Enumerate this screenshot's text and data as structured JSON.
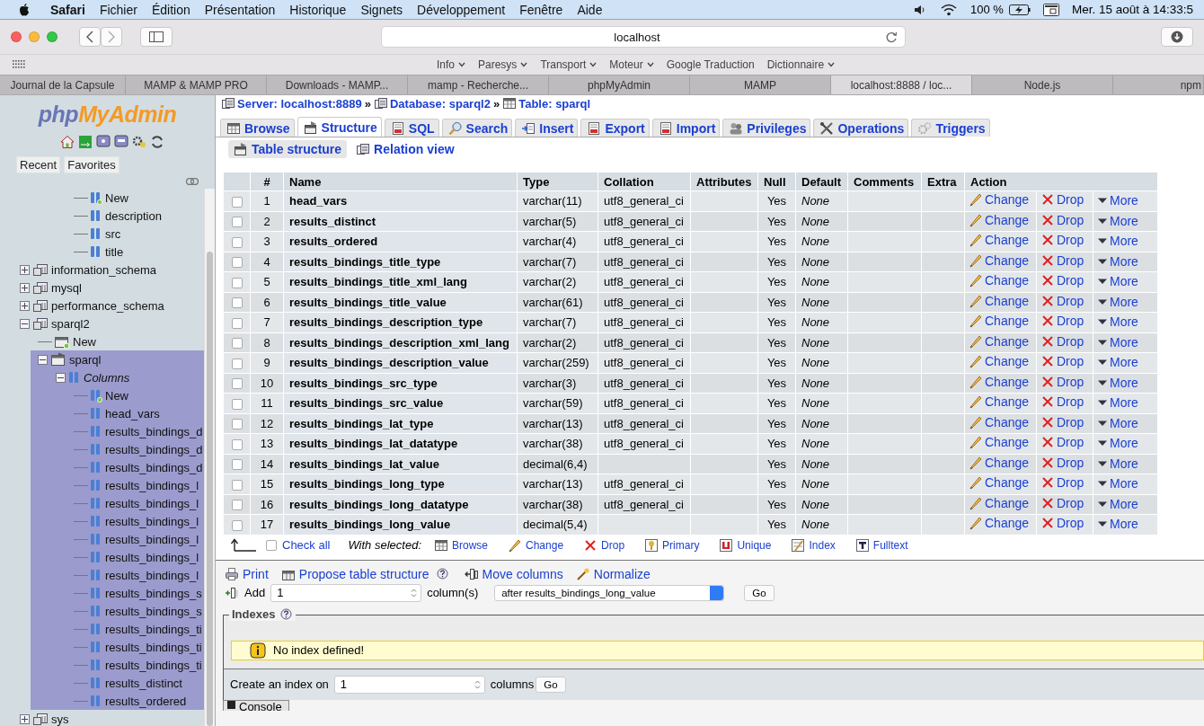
{
  "menu_bar": {
    "app": "Safari",
    "items": [
      "Fichier",
      "Édition",
      "Présentation",
      "Historique",
      "Signets",
      "Développement",
      "Fenêtre",
      "Aide"
    ],
    "battery": "100 %",
    "clock": "Mer. 15 août à 14:33:5"
  },
  "browser": {
    "address": "localhost",
    "favorites": [
      {
        "label": "Info",
        "dropdown": true
      },
      {
        "label": "Paresys",
        "dropdown": true
      },
      {
        "label": "Transport",
        "dropdown": true
      },
      {
        "label": "Moteur",
        "dropdown": true
      },
      {
        "label": "Google Traduction",
        "dropdown": false
      },
      {
        "label": "Dictionnaire",
        "dropdown": true
      }
    ],
    "tabs": [
      {
        "label": "Journal de la Capsule",
        "selected": false
      },
      {
        "label": "MAMP & MAMP PRO",
        "selected": false
      },
      {
        "label": "Downloads - MAMP...",
        "selected": false
      },
      {
        "label": "mamp - Recherche...",
        "selected": false
      },
      {
        "label": "phpMyAdmin",
        "selected": false
      },
      {
        "label": "MAMP",
        "selected": false
      },
      {
        "label": "localhost:8888 / loc...",
        "selected": true
      },
      {
        "label": "Node.js",
        "selected": false
      },
      {
        "label": "npm",
        "selected": false
      }
    ]
  },
  "sidebar": {
    "logo": {
      "first": "php",
      "second": "MyAdmin"
    },
    "buttons": [
      "Recent",
      "Favorites"
    ],
    "tree": [
      {
        "kind": "continued",
        "children": [
          {
            "kind": "continued",
            "children": [
              {
                "kind": "continued",
                "children": [
                  {
                    "label": "New",
                    "kind": "new-column"
                  },
                  {
                    "label": "description",
                    "kind": "column"
                  },
                  {
                    "label": "src",
                    "kind": "column"
                  },
                  {
                    "label": "title",
                    "kind": "column"
                  }
                ]
              }
            ]
          }
        ]
      },
      {
        "label": "information_schema",
        "kind": "database",
        "expanded": false,
        "selected": false
      },
      {
        "label": "mysql",
        "kind": "database",
        "expanded": false,
        "selected": false
      },
      {
        "label": "performance_schema",
        "kind": "database",
        "expanded": false,
        "selected": false
      },
      {
        "label": "sparql2",
        "kind": "database",
        "expanded": true,
        "selected": false,
        "children": [
          {
            "label": "New",
            "kind": "new-table"
          },
          {
            "label": "sparql",
            "kind": "table",
            "expanded": true,
            "selected": true,
            "children": [
              {
                "label": "Columns",
                "kind": "group",
                "expanded": true,
                "children": [
                  {
                    "label": "New",
                    "kind": "new-column"
                  },
                  {
                    "label": "head_vars",
                    "kind": "column"
                  },
                  {
                    "label": "results_bindings_d",
                    "kind": "column"
                  },
                  {
                    "label": "results_bindings_d",
                    "kind": "column"
                  },
                  {
                    "label": "results_bindings_d",
                    "kind": "column"
                  },
                  {
                    "label": "results_bindings_l",
                    "kind": "column"
                  },
                  {
                    "label": "results_bindings_l",
                    "kind": "column"
                  },
                  {
                    "label": "results_bindings_l",
                    "kind": "column"
                  },
                  {
                    "label": "results_bindings_l",
                    "kind": "column"
                  },
                  {
                    "label": "results_bindings_l",
                    "kind": "column"
                  },
                  {
                    "label": "results_bindings_l",
                    "kind": "column"
                  },
                  {
                    "label": "results_bindings_s",
                    "kind": "column"
                  },
                  {
                    "label": "results_bindings_s",
                    "kind": "column"
                  },
                  {
                    "label": "results_bindings_ti",
                    "kind": "column"
                  },
                  {
                    "label": "results_bindings_ti",
                    "kind": "column"
                  },
                  {
                    "label": "results_bindings_ti",
                    "kind": "column"
                  },
                  {
                    "label": "results_distinct",
                    "kind": "column"
                  },
                  {
                    "label": "results_ordered",
                    "kind": "column"
                  }
                ]
              }
            ]
          }
        ]
      },
      {
        "label": "sys",
        "kind": "database",
        "expanded": false,
        "selected": false
      }
    ]
  },
  "breadcrumb": [
    {
      "label": "Server: localhost:8889",
      "after": "»"
    },
    {
      "label": "Database: sparql2",
      "after": "»"
    },
    {
      "label": "Table: sparql"
    }
  ],
  "tabs": [
    {
      "label": "Browse",
      "selected": false
    },
    {
      "label": "Structure",
      "selected": true
    },
    {
      "label": "SQL",
      "selected": false
    },
    {
      "label": "Search",
      "selected": false
    },
    {
      "label": "Insert",
      "selected": false
    },
    {
      "label": "Export",
      "selected": false
    },
    {
      "label": "Import",
      "selected": false
    },
    {
      "label": "Privileges",
      "selected": false
    },
    {
      "label": "Operations",
      "selected": false
    },
    {
      "label": "Triggers",
      "selected": false
    }
  ],
  "subtabs": [
    {
      "label": "Table structure",
      "selected": true
    },
    {
      "label": "Relation view",
      "selected": false
    }
  ],
  "table": {
    "columns": [
      "#",
      "Name",
      "Type",
      "Collation",
      "Attributes",
      "Null",
      "Default",
      "Comments",
      "Extra",
      "Action"
    ],
    "rows": [
      {
        "checked": false,
        "num": "1",
        "name": "head_vars",
        "type": "varchar(11)",
        "collation": "utf8_general_ci",
        "null": "Yes",
        "default": "None",
        "actions": [
          "Change",
          "Drop",
          "More"
        ]
      },
      {
        "checked": false,
        "num": "2",
        "name": "results_distinct",
        "type": "varchar(5)",
        "collation": "utf8_general_ci",
        "null": "Yes",
        "default": "None",
        "actions": [
          "Change",
          "Drop",
          "More"
        ]
      },
      {
        "checked": false,
        "num": "3",
        "name": "results_ordered",
        "type": "varchar(4)",
        "collation": "utf8_general_ci",
        "null": "Yes",
        "default": "None",
        "actions": [
          "Change",
          "Drop",
          "More"
        ]
      },
      {
        "checked": false,
        "num": "4",
        "name": "results_bindings_title_type",
        "type": "varchar(7)",
        "collation": "utf8_general_ci",
        "null": "Yes",
        "default": "None",
        "actions": [
          "Change",
          "Drop",
          "More"
        ]
      },
      {
        "checked": false,
        "num": "5",
        "name": "results_bindings_title_xml_lang",
        "type": "varchar(2)",
        "collation": "utf8_general_ci",
        "null": "Yes",
        "default": "None",
        "actions": [
          "Change",
          "Drop",
          "More"
        ]
      },
      {
        "checked": false,
        "num": "6",
        "name": "results_bindings_title_value",
        "type": "varchar(61)",
        "collation": "utf8_general_ci",
        "null": "Yes",
        "default": "None",
        "actions": [
          "Change",
          "Drop",
          "More"
        ]
      },
      {
        "checked": false,
        "num": "7",
        "name": "results_bindings_description_type",
        "type": "varchar(7)",
        "collation": "utf8_general_ci",
        "null": "Yes",
        "default": "None",
        "actions": [
          "Change",
          "Drop",
          "More"
        ]
      },
      {
        "checked": false,
        "num": "8",
        "name": "results_bindings_description_xml_lang",
        "type": "varchar(2)",
        "collation": "utf8_general_ci",
        "null": "Yes",
        "default": "None",
        "actions": [
          "Change",
          "Drop",
          "More"
        ]
      },
      {
        "checked": false,
        "num": "9",
        "name": "results_bindings_description_value",
        "type": "varchar(259)",
        "collation": "utf8_general_ci",
        "null": "Yes",
        "default": "None",
        "actions": [
          "Change",
          "Drop",
          "More"
        ]
      },
      {
        "checked": false,
        "num": "10",
        "name": "results_bindings_src_type",
        "type": "varchar(3)",
        "collation": "utf8_general_ci",
        "null": "Yes",
        "default": "None",
        "actions": [
          "Change",
          "Drop",
          "More"
        ]
      },
      {
        "checked": false,
        "num": "11",
        "name": "results_bindings_src_value",
        "type": "varchar(59)",
        "collation": "utf8_general_ci",
        "null": "Yes",
        "default": "None",
        "actions": [
          "Change",
          "Drop",
          "More"
        ]
      },
      {
        "checked": false,
        "num": "12",
        "name": "results_bindings_lat_type",
        "type": "varchar(13)",
        "collation": "utf8_general_ci",
        "null": "Yes",
        "default": "None",
        "actions": [
          "Change",
          "Drop",
          "More"
        ]
      },
      {
        "checked": false,
        "num": "13",
        "name": "results_bindings_lat_datatype",
        "type": "varchar(38)",
        "collation": "utf8_general_ci",
        "null": "Yes",
        "default": "None",
        "actions": [
          "Change",
          "Drop",
          "More"
        ]
      },
      {
        "checked": false,
        "num": "14",
        "name": "results_bindings_lat_value",
        "type": "decimal(6,4)",
        "null": "Yes",
        "default": "None",
        "actions": [
          "Change",
          "Drop",
          "More"
        ]
      },
      {
        "checked": false,
        "num": "15",
        "name": "results_bindings_long_type",
        "type": "varchar(13)",
        "collation": "utf8_general_ci",
        "null": "Yes",
        "default": "None",
        "actions": [
          "Change",
          "Drop",
          "More"
        ]
      },
      {
        "checked": false,
        "num": "16",
        "name": "results_bindings_long_datatype",
        "type": "varchar(38)",
        "collation": "utf8_general_ci",
        "null": "Yes",
        "default": "None",
        "actions": [
          "Change",
          "Drop",
          "More"
        ]
      },
      {
        "checked": false,
        "num": "17",
        "name": "results_bindings_long_value",
        "type": "decimal(5,4)",
        "null": "Yes",
        "default": "None",
        "actions": [
          "Change",
          "Drop",
          "More"
        ]
      }
    ]
  },
  "bulk": {
    "check_all": "Check all",
    "checked": false,
    "with_selected": "With selected:",
    "actions": [
      "Browse",
      "Change",
      "Drop",
      "Primary",
      "Unique",
      "Index",
      "Fulltext"
    ]
  },
  "tools": [
    "Print",
    "Propose table structure",
    "Move columns",
    "Normalize"
  ],
  "add_columns": {
    "label": "Add",
    "value": "1",
    "unit": "column(s)",
    "position": "after results_bindings_long_value",
    "button": "Go"
  },
  "indexes": {
    "legend": "Indexes",
    "notice": "No index defined!",
    "create_label": "Create an index on",
    "value": "1",
    "unit": "columns",
    "button": "Go"
  },
  "console": "Console"
}
